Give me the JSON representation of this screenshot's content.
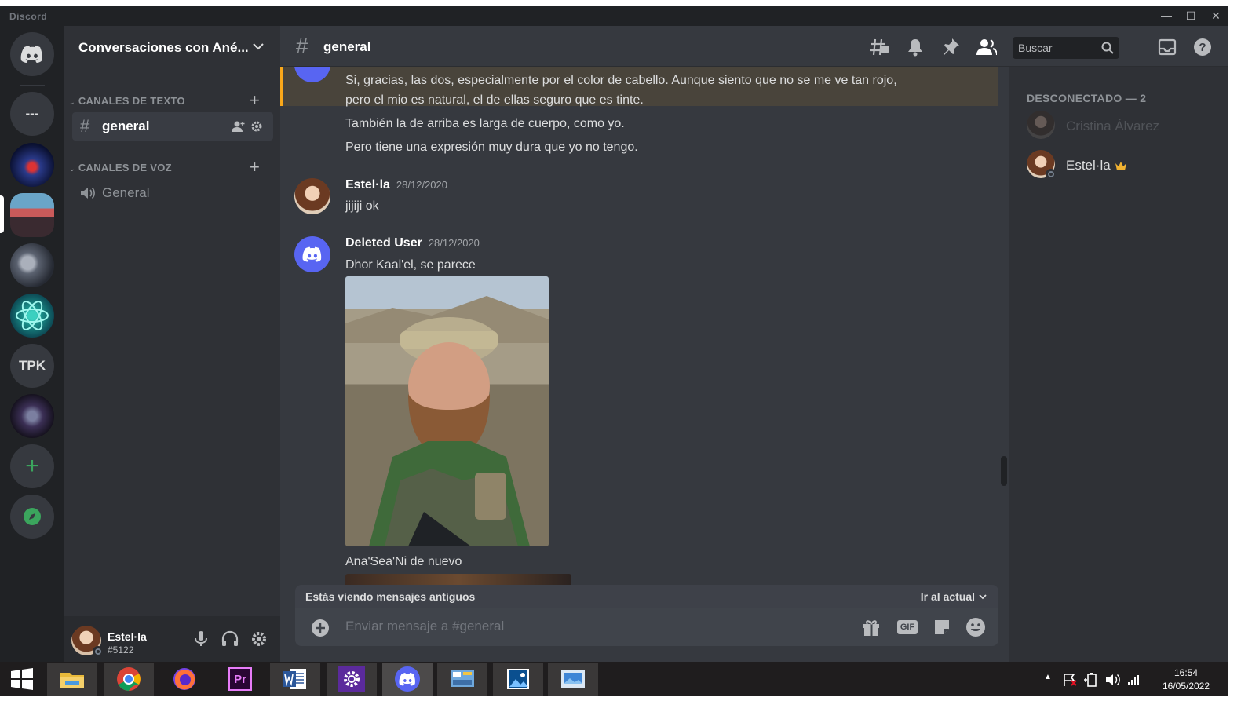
{
  "window": {
    "app_name": "Discord",
    "controls": [
      "minimize-icon",
      "maximize-icon",
      "close-icon"
    ]
  },
  "guilds": {
    "items": [
      {
        "type": "home",
        "icon": "discord-logo-icon"
      },
      {
        "type": "text",
        "label": "---"
      },
      {
        "type": "image",
        "icon": "server-concert-icon"
      },
      {
        "type": "image",
        "icon": "server-group-photo-icon",
        "active": true
      },
      {
        "type": "image",
        "icon": "server-spaceship-icon"
      },
      {
        "type": "image",
        "icon": "server-atom-icon"
      },
      {
        "type": "text",
        "label": "TPK"
      },
      {
        "type": "image",
        "icon": "server-dark-art-icon"
      },
      {
        "type": "action",
        "icon": "add-server-icon"
      },
      {
        "type": "action",
        "icon": "explore-compass-icon"
      }
    ]
  },
  "server": {
    "name": "Conversaciones con Ané...",
    "categories": [
      {
        "name": "CANALES DE TEXTO",
        "channels": [
          {
            "name": "general",
            "type": "text",
            "active": true
          }
        ]
      },
      {
        "name": "CANALES DE VOZ",
        "channels": [
          {
            "name": "General",
            "type": "voice"
          }
        ]
      }
    ]
  },
  "user_panel": {
    "username": "Estel·la",
    "tag": "#5122"
  },
  "channel": {
    "name": "general"
  },
  "search": {
    "placeholder": "Buscar"
  },
  "messages": {
    "highlight_lines": [
      "Si, gracias, las dos, especialmente por el color de cabello. Aunque siento que no se me ve tan rojo,",
      "pero  el mio es natural, el de ellas seguro que es tinte."
    ],
    "followup_lines": [
      "También la de arriba es larga de cuerpo,   como yo.",
      "Pero tiene una expresión muy dura que yo no tengo."
    ],
    "m1": {
      "author": "Estel·la",
      "timestamp": "28/12/2020",
      "text": "jijiji ok"
    },
    "m2": {
      "author": "Deleted User",
      "timestamp": "28/12/2020",
      "text": "Dhor Kaal'el,  se parece",
      "caption": "Ana'Sea'Ni   de nuevo"
    }
  },
  "banner": {
    "text": "Estás viendo mensajes antiguos",
    "jump_label": "Ir al actual"
  },
  "composer": {
    "placeholder": "Enviar mensaje a #general",
    "gif_label": "GIF"
  },
  "members": {
    "section": "DESCONECTADO — 2",
    "list": [
      {
        "name": "Cristina Álvarez",
        "dim": true
      },
      {
        "name": "Estel·la",
        "owner": true
      }
    ]
  },
  "taskbar": {
    "apps": [
      "windows-start-icon",
      "file-explorer-icon",
      "chrome-icon",
      "firefox-icon",
      "premiere-icon",
      "word-icon",
      "settings-icon",
      "discord-icon",
      "control-panel-icon",
      "photos-icon",
      "screenshot-icon"
    ],
    "time": "16:54",
    "date": "16/05/2022"
  },
  "colors": {
    "accent": "#5865f2",
    "highlight": "#faa81a",
    "online_green": "#3ba55d",
    "owner_crown": "#f0b232"
  }
}
